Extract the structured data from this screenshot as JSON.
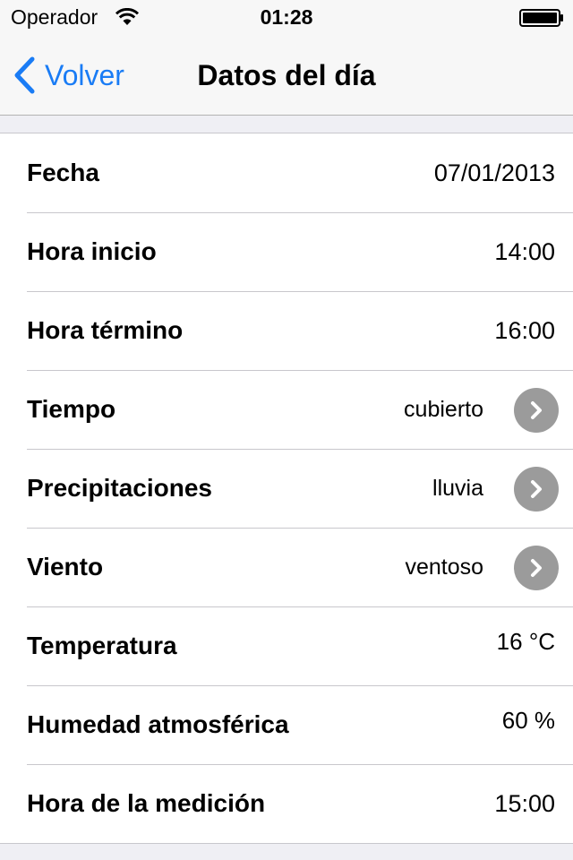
{
  "status_bar": {
    "carrier": "Operador",
    "time": "01:28"
  },
  "nav": {
    "back_label": "Volver",
    "title": "Datos del día"
  },
  "colors": {
    "accent": "#1a7cf5",
    "disclosure": "#9b9b9b",
    "background": "#efeff4"
  },
  "rows": [
    {
      "label": "Fecha",
      "value": "07/01/2013"
    },
    {
      "label": "Hora inicio",
      "value": "14:00"
    },
    {
      "label": "Hora término",
      "value": "16:00"
    },
    {
      "label": "Tiempo",
      "value": "cubierto",
      "disclosure_icon": "chevron-right-icon"
    },
    {
      "label": "Precipitaciones",
      "value": "lluvia",
      "disclosure_icon": "chevron-right-icon"
    },
    {
      "label": "Viento",
      "value": "ventoso",
      "disclosure_icon": "chevron-right-icon"
    },
    {
      "label": "Temperatura",
      "value": "16 °C"
    },
    {
      "label": "Humedad atmosférica",
      "value": "60 %"
    },
    {
      "label": "Hora de la medición",
      "value": "15:00"
    }
  ]
}
